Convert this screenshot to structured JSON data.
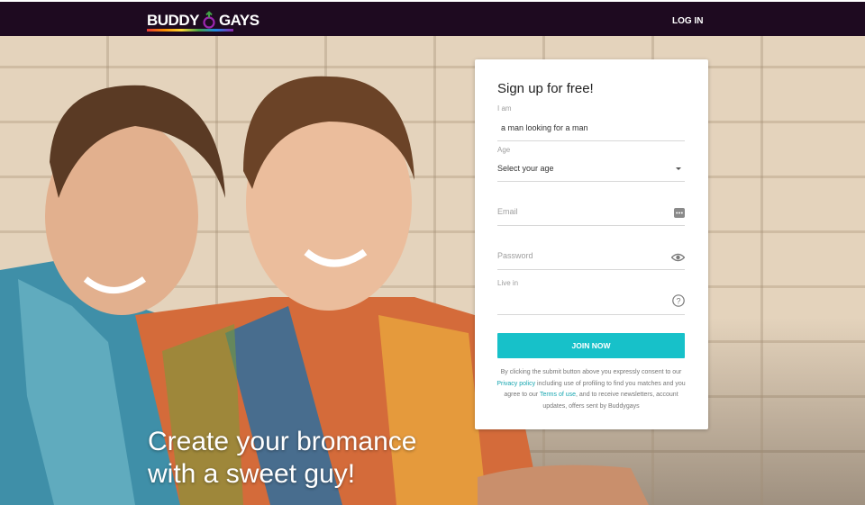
{
  "header": {
    "logo_left": "BUDDY",
    "logo_right": "GAYS",
    "login_label": "LOG IN"
  },
  "hero": {
    "headline_line1": "Create your bromance",
    "headline_line2": "with a sweet guy!"
  },
  "form": {
    "title": "Sign up for free!",
    "i_am_label": "I am",
    "i_am_value": "a man looking for a man",
    "age_label": "Age",
    "age_value": "Select your age",
    "email_placeholder": "Email",
    "password_placeholder": "Password",
    "live_in_label": "Live in",
    "join_label": "JOIN NOW",
    "legal_1": "By clicking the submit button above you expressly consent to our ",
    "privacy_link": "Privacy policy",
    "legal_2": " including use of profiling to find you matches and you agree to our ",
    "terms_link": "Terms of use",
    "legal_3": ", and to receive newsletters, account updates, offers sent by Buddygays"
  },
  "colors": {
    "header_bg": "#1e0a20",
    "accent": "#17c1c9"
  },
  "icons": [
    "gender-symbol-icon",
    "dropdown-caret-icon",
    "email-dots-icon",
    "eye-icon",
    "help-question-icon"
  ]
}
